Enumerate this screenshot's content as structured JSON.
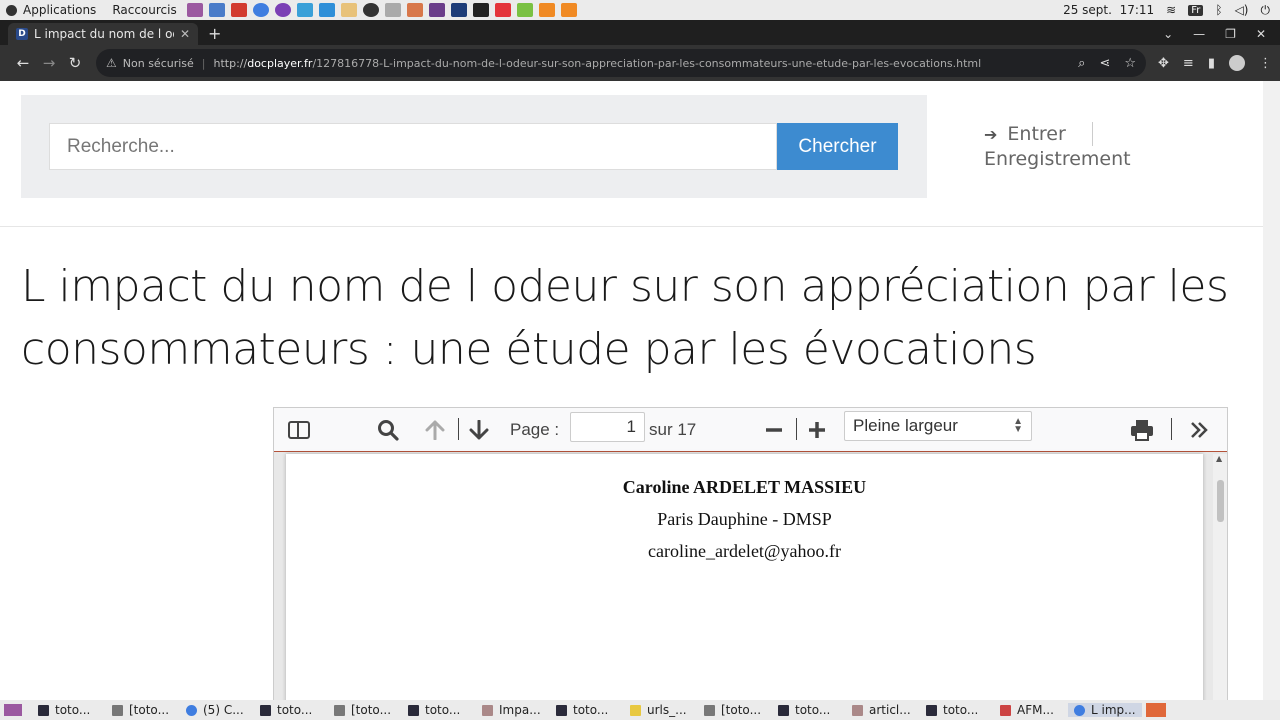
{
  "system_bar": {
    "applications": "Applications",
    "shortcuts": "Raccourcis",
    "date": "25 sept.",
    "time": "17:11",
    "keyboard": "Fr"
  },
  "tab": {
    "title": "L impact du nom de l odeur",
    "favicon": "D"
  },
  "address_bar": {
    "security": "Non sécurisé",
    "scheme": "http://",
    "host": "docplayer.fr",
    "path": "/127816778-L-impact-du-nom-de-l-odeur-sur-son-appreciation-par-les-consommateurs-une-etude-par-les-evocations.html"
  },
  "header": {
    "search_placeholder": "Recherche...",
    "search_button": "Chercher",
    "login": "Entrer",
    "register": "Enregistrement"
  },
  "page_title": "L impact du nom de l odeur sur son appréciation par les consommateurs : une étude par les évocations",
  "pdf_viewer": {
    "page_label": "Page :",
    "page_number": "1",
    "page_count": "sur 17",
    "zoom": "Pleine largeur",
    "lines": [
      "Caroline ARDELET MASSIEU",
      "Paris Dauphine - DMSP",
      "caroline_ardelet@yahoo.fr"
    ]
  },
  "taskbar": {
    "items": [
      "toto...",
      "[toto...",
      "(5) C...",
      "toto...",
      "[toto...",
      "toto...",
      "Impa...",
      "toto...",
      "urls_...",
      "[toto...",
      "toto...",
      "articl...",
      "toto...",
      "AFM...",
      "L imp..."
    ]
  }
}
